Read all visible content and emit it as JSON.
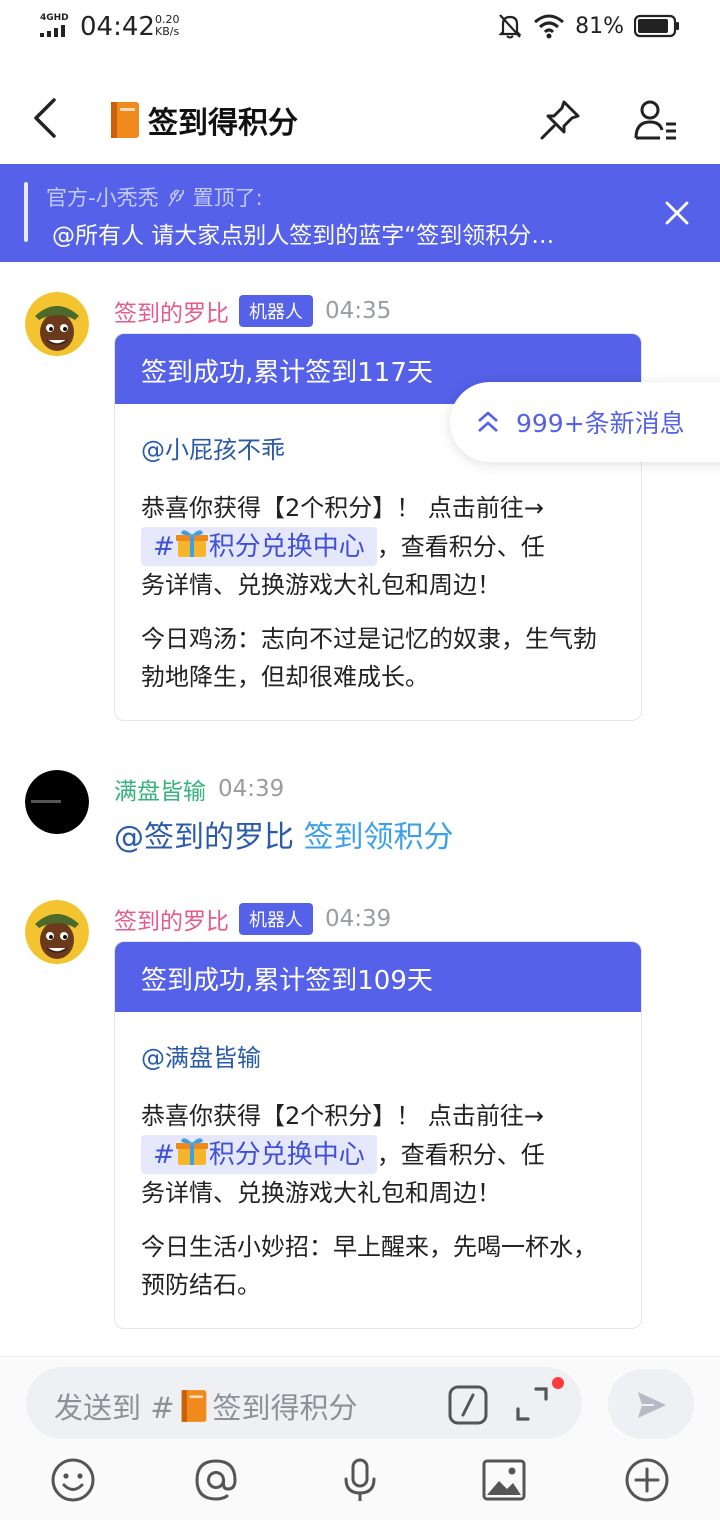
{
  "status_bar": {
    "network": "4GHD",
    "time": "04:42",
    "speed_value": "0.20",
    "speed_unit": "KB/s",
    "battery": "81%"
  },
  "header": {
    "title": "签到得积分",
    "title_icon": "book-icon",
    "back_icon": "back-icon",
    "pin_icon": "pin-icon",
    "members_icon": "members-icon"
  },
  "pinned": {
    "author": "官方-小秃秃",
    "pinned_label": "置顶了:",
    "text": "@所有人 请大家点别人签到的蓝字“签到领积分…",
    "bg_color": "#5461e8"
  },
  "new_messages": {
    "label": "999+条新消息"
  },
  "messages": [
    {
      "sender": "签到的罗比",
      "tag": "机器人",
      "time": "04:35",
      "card_title": "签到成功,累计签到117天",
      "mention": "@小屁孩不乖",
      "line1": "恭喜你获得【2个积分】！ 点击前往→",
      "link": "#🎁积分兑换中心",
      "link_text": "积分兑换中心",
      "line2_tail": "，查看积分、任",
      "line3": "务详情、兑换游戏大礼包和周边！",
      "extra": "今日鸡汤：志向不过是记忆的奴隶，生气勃勃地降生，但却很难成长。"
    },
    {
      "sender": "满盘皆输",
      "time": "04:39",
      "at_user": "@签到的罗比",
      "command": "签到领积分"
    },
    {
      "sender": "签到的罗比",
      "tag": "机器人",
      "time": "04:39",
      "card_title": "签到成功,累计签到109天",
      "mention": "@满盘皆输",
      "line1": "恭喜你获得【2个积分】！ 点击前往→",
      "link": "#🎁积分兑换中心",
      "link_text": "积分兑换中心",
      "line2_tail": "，查看积分、任",
      "line3": "务详情、兑换游戏大礼包和周边！",
      "extra": "今日生活小妙招：早上醒来，先喝一杯水，预防结石。"
    }
  ],
  "composer": {
    "placeholder_prefix": "发送到 #",
    "placeholder_channel": "签到得积分"
  },
  "toolbar": {
    "icons": [
      "emoji-icon",
      "at-icon",
      "microphone-icon",
      "image-icon",
      "plus-icon"
    ]
  },
  "colors": {
    "accent": "#5461e8",
    "bot_name": "#e85a8a",
    "user_name": "#35b47e",
    "mention": "#2a5aa8"
  }
}
